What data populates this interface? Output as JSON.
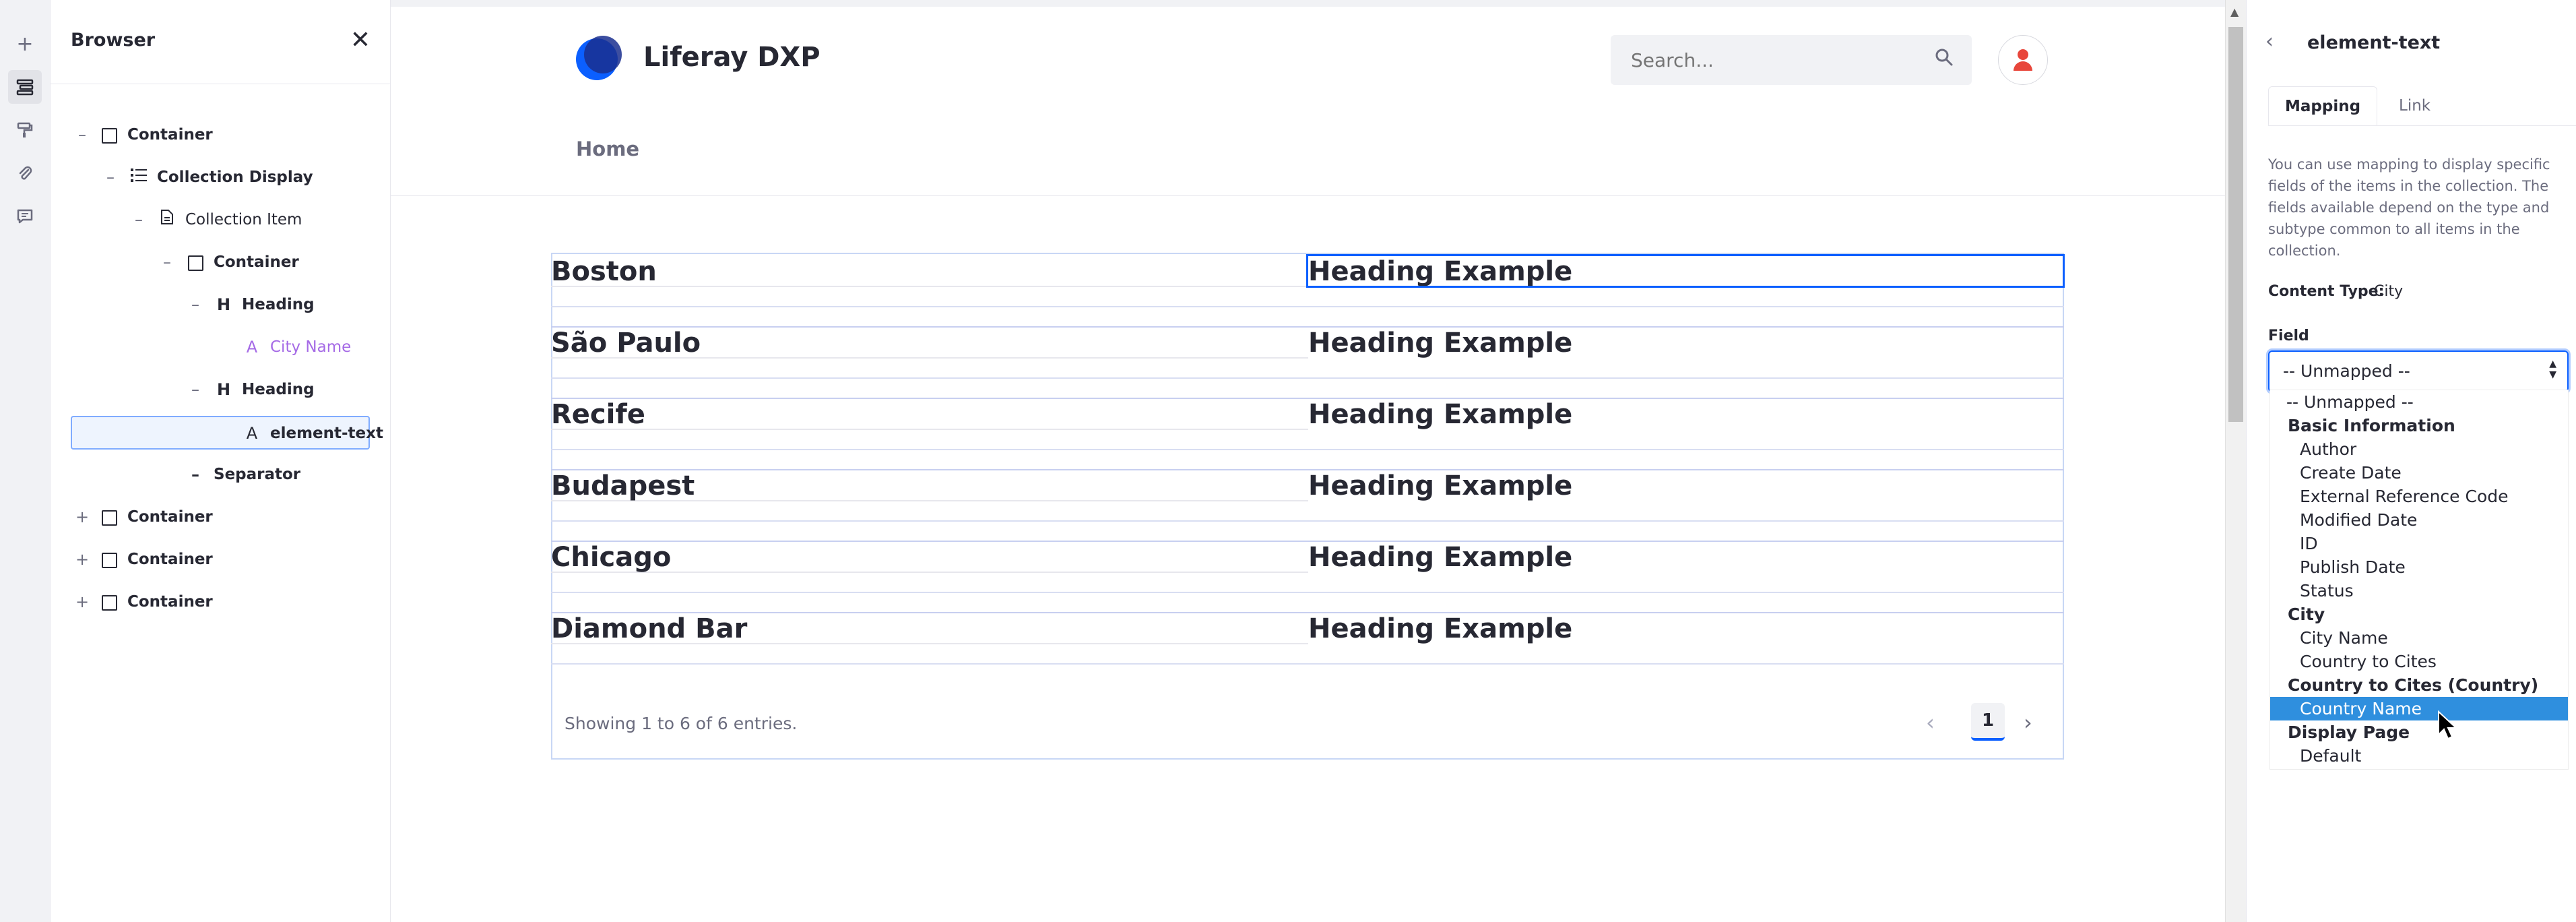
{
  "rail": {
    "add_symbol": "+",
    "icons": [
      "plus-icon",
      "browser-icon",
      "paint-roller-icon",
      "paperclip-icon",
      "comments-icon"
    ]
  },
  "browser": {
    "title": "Browser",
    "close_symbol": "✕",
    "tree": [
      {
        "toggle": "–",
        "label": "Container"
      },
      {
        "toggle": "–",
        "label": "Collection Display"
      },
      {
        "toggle": "–",
        "label": "Collection Item"
      },
      {
        "toggle": "–",
        "label": "Container"
      },
      {
        "toggle": "–",
        "icon_text": "H",
        "label": "Heading"
      },
      {
        "toggle": "",
        "icon_text": "A",
        "label": "City Name"
      },
      {
        "toggle": "–",
        "icon_text": "H",
        "label": "Heading"
      },
      {
        "toggle": "",
        "icon_text": "A",
        "label": "element-text"
      },
      {
        "toggle": "",
        "icon_text": "–",
        "label": "Separator"
      },
      {
        "toggle": "+",
        "label": "Container"
      },
      {
        "toggle": "+",
        "label": "Container"
      },
      {
        "toggle": "+",
        "label": "Container"
      }
    ]
  },
  "site": {
    "name": "Liferay DXP",
    "search_placeholder": "Search...",
    "nav": [
      "Home"
    ]
  },
  "collection": {
    "rows": [
      {
        "city": "Boston",
        "heading": "Heading Example"
      },
      {
        "city": "São Paulo",
        "heading": "Heading Example"
      },
      {
        "city": "Recife",
        "heading": "Heading Example"
      },
      {
        "city": "Budapest",
        "heading": "Heading Example"
      },
      {
        "city": "Chicago",
        "heading": "Heading Example"
      },
      {
        "city": "Diamond Bar",
        "heading": "Heading Example"
      }
    ],
    "showing_text": "Showing 1 to 6 of 6 entries.",
    "current_page": "1",
    "prev_symbol": "‹",
    "next_symbol": "›"
  },
  "config": {
    "back_symbol": "‹",
    "title": "element-text",
    "tabs": [
      "Mapping",
      "Link"
    ],
    "help_text": "You can use mapping to display specific fields of the items in the collection. The fields available depend on the type and subtype common to all items in the collection.",
    "content_type_label": "Content Type:",
    "content_type_value": "City",
    "field_label": "Field",
    "field_value": "-- Unmapped --",
    "options": [
      {
        "label": "-- Unmapped --",
        "kind": "first"
      },
      {
        "label": "Basic Information",
        "kind": "group"
      },
      {
        "label": "Author",
        "kind": "item"
      },
      {
        "label": "Create Date",
        "kind": "item"
      },
      {
        "label": "External Reference Code",
        "kind": "item"
      },
      {
        "label": "Modified Date",
        "kind": "item"
      },
      {
        "label": "ID",
        "kind": "item"
      },
      {
        "label": "Publish Date",
        "kind": "item"
      },
      {
        "label": "Status",
        "kind": "item"
      },
      {
        "label": "City",
        "kind": "group"
      },
      {
        "label": "City Name",
        "kind": "item"
      },
      {
        "label": "Country to Cites",
        "kind": "item"
      },
      {
        "label": "Country to Cites (Country)",
        "kind": "group"
      },
      {
        "label": "Country Name",
        "kind": "item",
        "highlighted": true
      },
      {
        "label": "Display Page",
        "kind": "group"
      },
      {
        "label": "Default",
        "kind": "item"
      }
    ]
  },
  "colors": {
    "accent": "#0b5fff",
    "highlight": "#2f8fde",
    "purple_mapped": "#a56ae6",
    "avatar": "#e8463b"
  }
}
